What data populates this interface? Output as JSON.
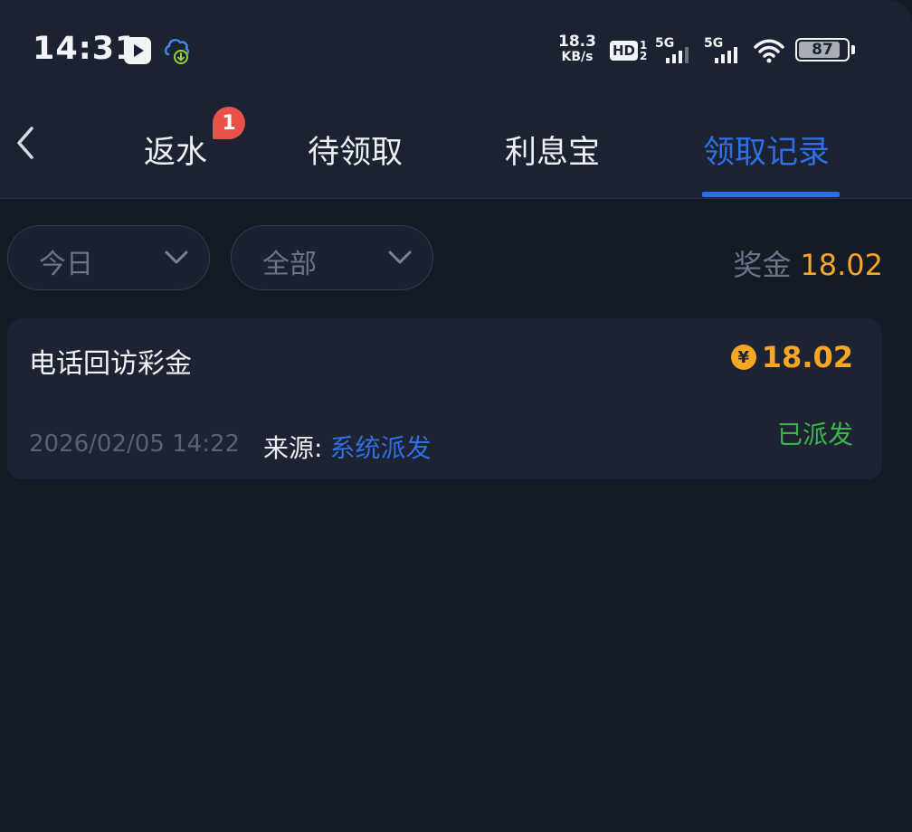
{
  "status_bar": {
    "time": "14:31",
    "net_speed_value": "18.3",
    "net_speed_unit": "KB/s",
    "hd_label": "HD",
    "hd_sim_top": "1",
    "hd_sim_bottom": "2",
    "sim1_label": "5G",
    "sim2_label": "5G",
    "battery_percent": "87",
    "battery_level": 0.87,
    "icons": [
      "play-icon",
      "download-icon",
      "wifi-icon",
      "battery-icon"
    ]
  },
  "nav": {
    "back_icon": "chevron-left-icon",
    "tabs": [
      {
        "label": "返水",
        "badge": "1",
        "active": false
      },
      {
        "label": "待领取",
        "active": false
      },
      {
        "label": "利息宝",
        "active": false
      },
      {
        "label": "领取记录",
        "active": true
      }
    ]
  },
  "filters": {
    "date_label": "今日",
    "type_label": "全部",
    "bonus_label": "奖金",
    "bonus_value": "18.02"
  },
  "records": [
    {
      "title": "电话回访彩金",
      "currency_symbol": "¥",
      "amount": "18.02",
      "time": "2026/02/05 14:22",
      "source_label": "来源:",
      "source_value": "系统派发",
      "status": "已派发"
    }
  ],
  "colors": {
    "accent": "#2f6fe6",
    "amount": "#f5a623",
    "success": "#3bb54a",
    "badge": "#e8524a"
  }
}
